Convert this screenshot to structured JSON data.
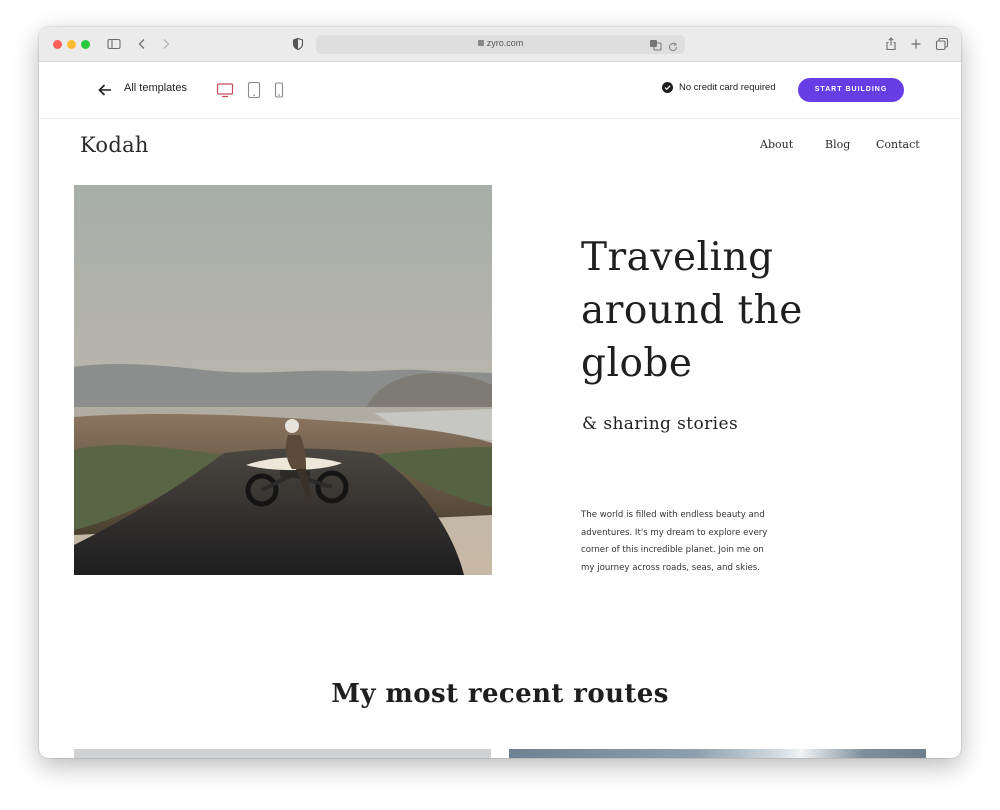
{
  "browser": {
    "url": "zyro.com"
  },
  "editor_bar": {
    "back_label": "All templates",
    "devices": [
      "desktop-icon",
      "tablet-icon",
      "mobile-icon"
    ],
    "no_credit_card": "No credit card required",
    "start_button": "START BUILDING",
    "accent_color": "#673de6",
    "active_device_color": "#c84a5c"
  },
  "site": {
    "logo": "Kodah",
    "nav": [
      "About",
      "Blog",
      "Contact"
    ],
    "hero": {
      "title_lines": [
        "Traveling",
        "around the",
        "globe"
      ],
      "subtitle": "& sharing stories",
      "body_lines": [
        "The world is filled with endless beauty and",
        "adventures. It's my dream to explore every",
        "corner of this incredible planet. Join me on",
        "my journey across roads, seas, and skies."
      ]
    },
    "section_title": "My most recent routes"
  }
}
